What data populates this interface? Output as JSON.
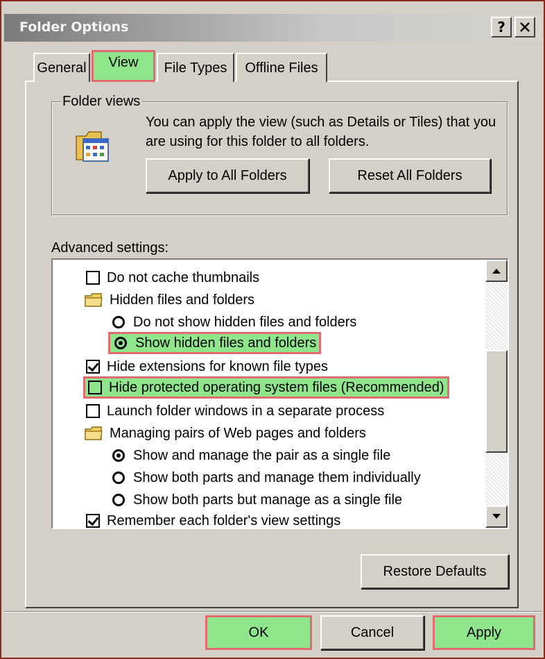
{
  "window": {
    "title": "Folder Options",
    "help_button": "?",
    "close_button": "✕"
  },
  "tabs": [
    {
      "label": "General",
      "active": false
    },
    {
      "label": "View",
      "active": true
    },
    {
      "label": "File Types",
      "active": false
    },
    {
      "label": "Offline Files",
      "active": false
    }
  ],
  "folder_views": {
    "group_label": "Folder views",
    "description": "You can apply the view (such as Details or Tiles) that you are using for this folder to all folders.",
    "apply_button": "Apply to All Folders",
    "reset_button": "Reset All Folders"
  },
  "advanced": {
    "label": "Advanced settings:",
    "items": [
      {
        "type": "checkbox",
        "label": "Do not cache thumbnails",
        "checked": false,
        "highlighted": false
      },
      {
        "type": "folder",
        "label": "Hidden files and folders"
      },
      {
        "type": "radio",
        "label": "Do not show hidden files and folders",
        "checked": false,
        "highlighted": false
      },
      {
        "type": "radio",
        "label": "Show hidden files and folders",
        "checked": true,
        "highlighted": true
      },
      {
        "type": "checkbox",
        "label": "Hide extensions for known file types",
        "checked": true,
        "highlighted": false
      },
      {
        "type": "checkbox",
        "label": "Hide protected operating system files (Recommended)",
        "checked": false,
        "highlighted": true
      },
      {
        "type": "checkbox",
        "label": "Launch folder windows in a separate process",
        "checked": false,
        "highlighted": false
      },
      {
        "type": "folder",
        "label": "Managing pairs of Web pages and folders"
      },
      {
        "type": "radio",
        "label": "Show and manage the pair as a single file",
        "checked": true,
        "highlighted": false
      },
      {
        "type": "radio",
        "label": "Show both parts and manage them individually",
        "checked": false,
        "highlighted": false
      },
      {
        "type": "radio",
        "label": "Show both parts but manage as a single file",
        "checked": false,
        "highlighted": false
      },
      {
        "type": "checkbox",
        "label": "Remember each folder's view settings",
        "checked": true,
        "highlighted": false
      }
    ]
  },
  "restore_button": "Restore Defaults",
  "footer": {
    "ok": "OK",
    "cancel": "Cancel",
    "apply": "Apply"
  },
  "colors": {
    "highlight_fill": "#8fe68a",
    "highlight_border": "#e06b70",
    "dialog_face": "#d4d0c8"
  }
}
